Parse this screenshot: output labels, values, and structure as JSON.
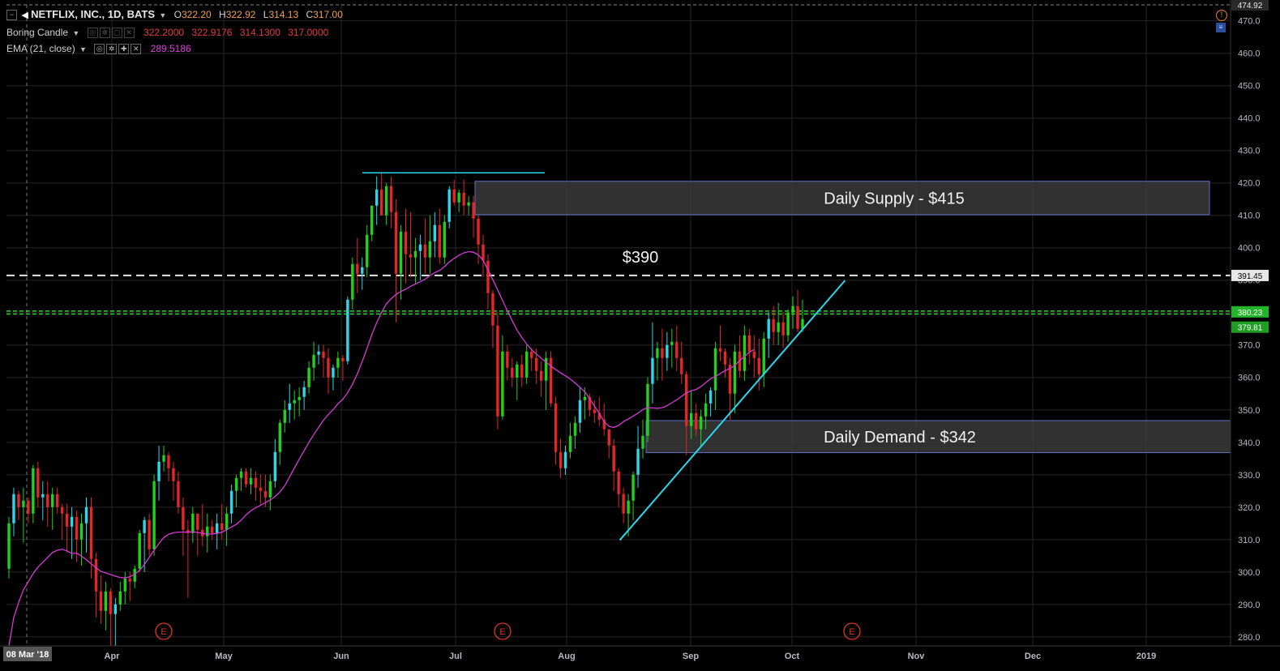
{
  "header": {
    "symbol": "NETFLIX, INC., 1D, BATS",
    "o_label": "O",
    "o_value": "322.20",
    "h_label": "H",
    "h_value": "322.92",
    "l_label": "L",
    "l_value": "314.13",
    "c_label": "C",
    "c_value": "317.00"
  },
  "indicators": {
    "candle_label": "Boring Candle",
    "candle_values": [
      "322.2000",
      "322.9176",
      "314.1300",
      "317.0000"
    ],
    "ema_label": "EMA (21, close)",
    "ema_value": "289.5186"
  },
  "colors": {
    "up_green": "#22d11c",
    "up_cyan": "#2fd5e8",
    "down_red": "#e32727",
    "ema": "#d63ad6",
    "trendline": "#27d9f0",
    "grid": "#262626",
    "zone_fill": "#3a3a3a",
    "zone_border": "#5f6fc4",
    "green_line": "#2fd32f"
  },
  "chart_data": {
    "type": "candlestick",
    "x_axis_labels": [
      "08 Mar '18",
      "Apr",
      "May",
      "Jun",
      "Jul",
      "Aug",
      "Sep",
      "Oct",
      "Nov",
      "Dec",
      "2019"
    ],
    "y_ticks": [
      470,
      460,
      450,
      440,
      430,
      420,
      410,
      400,
      390,
      380,
      370,
      360,
      350,
      340,
      330,
      320,
      310,
      300,
      290,
      280
    ],
    "ylim": [
      277.2,
      474.92
    ],
    "price_tags": {
      "top": "474.92",
      "white_line": "391.45",
      "green_1": "380.23",
      "green_2": "379.81"
    },
    "zones": [
      {
        "label": "Daily Supply - $415",
        "low": 410.2,
        "high": 420.5
      },
      {
        "label": "Daily Demand - $342",
        "low": 336.8,
        "high": 346.7
      }
    ],
    "level_label": "$390",
    "white_line_level": 391.45,
    "green_levels": [
      380.23,
      379.81
    ],
    "resistance_top": 423.1,
    "earnings_marker": "E",
    "candles_ohlc": [
      [
        301,
        317,
        298,
        315
      ],
      [
        315,
        326,
        311,
        324
      ],
      [
        324,
        325,
        316,
        320
      ],
      [
        320,
        326,
        309,
        322
      ],
      [
        322,
        323,
        315,
        318
      ],
      [
        318,
        333,
        315,
        332
      ],
      [
        332,
        334,
        320,
        323
      ],
      [
        323,
        328,
        316,
        324
      ],
      [
        324,
        328,
        314,
        320
      ],
      [
        320,
        326,
        313,
        324
      ],
      [
        324,
        326,
        318,
        320
      ],
      [
        320,
        321,
        310,
        318
      ],
      [
        318,
        321,
        306,
        314
      ],
      [
        314,
        320,
        304,
        317
      ],
      [
        317,
        319,
        303,
        310
      ],
      [
        310,
        318,
        302,
        315
      ],
      [
        315,
        323,
        306,
        320
      ],
      [
        320,
        323,
        298,
        304
      ],
      [
        304,
        306,
        286,
        294
      ],
      [
        294,
        299,
        284,
        288
      ],
      [
        288,
        297,
        282,
        294
      ],
      [
        294,
        295,
        276,
        287
      ],
      [
        287,
        292,
        276,
        290
      ],
      [
        290,
        297,
        288,
        294
      ],
      [
        294,
        300,
        290,
        298
      ],
      [
        298,
        300,
        291,
        297
      ],
      [
        297,
        302,
        295,
        301
      ],
      [
        301,
        313,
        300,
        312
      ],
      [
        312,
        317,
        300,
        316
      ],
      [
        316,
        318,
        305,
        307
      ],
      [
        307,
        330,
        305,
        328
      ],
      [
        328,
        339,
        322,
        334
      ],
      [
        334,
        339,
        331,
        336
      ],
      [
        336,
        337,
        328,
        332
      ],
      [
        332,
        334,
        322,
        328
      ],
      [
        328,
        331,
        318,
        320
      ],
      [
        320,
        323,
        305,
        313
      ],
      [
        313,
        316,
        292,
        312
      ],
      [
        312,
        320,
        309,
        318
      ],
      [
        318,
        318,
        305,
        313
      ],
      [
        313,
        321,
        308,
        311
      ],
      [
        311,
        318,
        306,
        314
      ],
      [
        314,
        316,
        310,
        312
      ],
      [
        312,
        318,
        307,
        315
      ],
      [
        315,
        321,
        310,
        313
      ],
      [
        313,
        320,
        308,
        318
      ],
      [
        318,
        327,
        315,
        325
      ],
      [
        325,
        330,
        320,
        329
      ],
      [
        329,
        332,
        325,
        331
      ],
      [
        331,
        332,
        326,
        327
      ],
      [
        327,
        332,
        324,
        329
      ],
      [
        329,
        331,
        322,
        326
      ],
      [
        326,
        330,
        321,
        325
      ],
      [
        325,
        330,
        320,
        323
      ],
      [
        323,
        330,
        319,
        328
      ],
      [
        328,
        341,
        326,
        337
      ],
      [
        337,
        347,
        333,
        346
      ],
      [
        346,
        353,
        343,
        350
      ],
      [
        350,
        358,
        346,
        352
      ],
      [
        352,
        356,
        347,
        353
      ],
      [
        353,
        357,
        348,
        354
      ],
      [
        354,
        359,
        350,
        357
      ],
      [
        357,
        365,
        355,
        363
      ],
      [
        363,
        371,
        359,
        367
      ],
      [
        367,
        370,
        364,
        368
      ],
      [
        368,
        370,
        360,
        366
      ],
      [
        366,
        369,
        355,
        360
      ],
      [
        360,
        364,
        356,
        363
      ],
      [
        363,
        368,
        360,
        366
      ],
      [
        366,
        367,
        359,
        365
      ],
      [
        365,
        385,
        364,
        384
      ],
      [
        384,
        397,
        381,
        395
      ],
      [
        395,
        403,
        386,
        392
      ],
      [
        392,
        397,
        387,
        394
      ],
      [
        394,
        407,
        391,
        404
      ],
      [
        404,
        413,
        402,
        413
      ],
      [
        413,
        422,
        407,
        418
      ],
      [
        418,
        423,
        410,
        410
      ],
      [
        410,
        420,
        407,
        419
      ],
      [
        419,
        422,
        406,
        411
      ],
      [
        411,
        415,
        377,
        392
      ],
      [
        392,
        407,
        384,
        405
      ],
      [
        405,
        412,
        389,
        398
      ],
      [
        398,
        411,
        391,
        397
      ],
      [
        397,
        403,
        389,
        399
      ],
      [
        399,
        404,
        390,
        401
      ],
      [
        401,
        409,
        392,
        397
      ],
      [
        397,
        410,
        392,
        402
      ],
      [
        402,
        411,
        397,
        407
      ],
      [
        407,
        412,
        395,
        397
      ],
      [
        397,
        410,
        395,
        408
      ],
      [
        408,
        419,
        406,
        418
      ],
      [
        418,
        421,
        413,
        414
      ],
      [
        414,
        418,
        411,
        417
      ],
      [
        417,
        421,
        410,
        413
      ],
      [
        413,
        416,
        410,
        414
      ],
      [
        414,
        416,
        403,
        409
      ],
      [
        409,
        410,
        395,
        401
      ],
      [
        401,
        404,
        391,
        396
      ],
      [
        396,
        398,
        381,
        386
      ],
      [
        386,
        387,
        369,
        376
      ],
      [
        376,
        380,
        344,
        348
      ],
      [
        348,
        373,
        347,
        368
      ],
      [
        368,
        370,
        359,
        363
      ],
      [
        363,
        366,
        357,
        360
      ],
      [
        360,
        365,
        353,
        364
      ],
      [
        364,
        367,
        357,
        360
      ],
      [
        360,
        370,
        358,
        368
      ],
      [
        368,
        369,
        362,
        366
      ],
      [
        366,
        369,
        358,
        362
      ],
      [
        362,
        365,
        354,
        359
      ],
      [
        359,
        368,
        350,
        366
      ],
      [
        366,
        368,
        351,
        352
      ],
      [
        352,
        354,
        333,
        337
      ],
      [
        337,
        341,
        329,
        332
      ],
      [
        332,
        339,
        330,
        337
      ],
      [
        337,
        346,
        335,
        342
      ],
      [
        342,
        348,
        338,
        346
      ],
      [
        346,
        357,
        343,
        353
      ],
      [
        353,
        357,
        347,
        354
      ],
      [
        354,
        355,
        348,
        350
      ],
      [
        350,
        353,
        346,
        349
      ],
      [
        349,
        354,
        345,
        347
      ],
      [
        347,
        352,
        342,
        344
      ],
      [
        344,
        344,
        335,
        339
      ],
      [
        339,
        341,
        325,
        331
      ],
      [
        331,
        332,
        320,
        324
      ],
      [
        324,
        326,
        315,
        318
      ],
      [
        318,
        324,
        311,
        322
      ],
      [
        322,
        331,
        316,
        330
      ],
      [
        330,
        345,
        326,
        338
      ],
      [
        338,
        347,
        335,
        342
      ],
      [
        342,
        360,
        340,
        358
      ],
      [
        358,
        377,
        352,
        366
      ],
      [
        366,
        371,
        359,
        369
      ],
      [
        369,
        375,
        359,
        366
      ],
      [
        366,
        374,
        362,
        370
      ],
      [
        370,
        375,
        363,
        371
      ],
      [
        371,
        376,
        362,
        366
      ],
      [
        366,
        371,
        358,
        361
      ],
      [
        361,
        362,
        336,
        345
      ],
      [
        345,
        356,
        341,
        349
      ],
      [
        349,
        352,
        342,
        344
      ],
      [
        344,
        350,
        339,
        348
      ],
      [
        348,
        355,
        344,
        352
      ],
      [
        352,
        357,
        348,
        356
      ],
      [
        356,
        371,
        350,
        369
      ],
      [
        369,
        376,
        365,
        368
      ],
      [
        368,
        369,
        360,
        364
      ],
      [
        364,
        366,
        347,
        355
      ],
      [
        355,
        370,
        349,
        368
      ],
      [
        368,
        373,
        360,
        362
      ],
      [
        362,
        376,
        359,
        373
      ],
      [
        373,
        375,
        364,
        368
      ],
      [
        368,
        373,
        360,
        366
      ],
      [
        366,
        372,
        356,
        361
      ],
      [
        361,
        374,
        357,
        372
      ],
      [
        372,
        380,
        366,
        378
      ],
      [
        378,
        382,
        370,
        374
      ],
      [
        374,
        383,
        370,
        377
      ],
      [
        377,
        380,
        369,
        373
      ],
      [
        373,
        381,
        371,
        380
      ],
      [
        380,
        385,
        375,
        382
      ],
      [
        382,
        387,
        374,
        375
      ],
      [
        375,
        384,
        374,
        378
      ]
    ],
    "ema_21": [
      [
        0,
        277.2
      ],
      [
        1,
        286
      ],
      [
        2,
        290.5
      ],
      [
        3,
        294.5
      ],
      [
        4,
        297
      ],
      [
        5,
        299.5
      ],
      [
        6,
        301.5
      ],
      [
        7,
        303
      ],
      [
        8,
        304.5
      ],
      [
        9,
        306
      ],
      [
        10,
        306.7
      ],
      [
        11,
        307
      ],
      [
        12,
        306.5
      ],
      [
        13,
        305.7
      ],
      [
        14,
        305.8
      ],
      [
        15,
        304.9
      ],
      [
        16,
        303.8
      ],
      [
        17,
        302.5
      ],
      [
        18,
        301.3
      ],
      [
        19,
        300.2
      ],
      [
        20,
        299.7
      ],
      [
        21,
        299.2
      ],
      [
        22,
        298.7
      ],
      [
        23,
        298.3
      ],
      [
        24,
        298.2
      ],
      [
        25,
        298.5
      ],
      [
        26,
        299.3
      ],
      [
        27,
        300.5
      ],
      [
        28,
        302.3
      ],
      [
        29,
        304.5
      ],
      [
        30,
        306.7
      ],
      [
        31,
        308.8
      ],
      [
        32,
        310.6
      ],
      [
        33,
        311.6
      ],
      [
        34,
        312.1
      ],
      [
        35,
        312.3
      ],
      [
        36,
        312.3
      ],
      [
        37,
        312.3
      ],
      [
        38,
        312.4
      ],
      [
        39,
        312.2
      ],
      [
        40,
        311.9
      ],
      [
        41,
        311.7
      ],
      [
        42,
        311.7
      ],
      [
        43,
        311.9
      ],
      [
        44,
        312.3
      ],
      [
        45,
        313
      ],
      [
        46,
        313.9
      ],
      [
        47,
        314.7
      ],
      [
        48,
        316
      ],
      [
        49,
        317.6
      ],
      [
        50,
        318.9
      ],
      [
        51,
        319.8
      ],
      [
        52,
        320.6
      ],
      [
        53,
        321.4
      ],
      [
        54,
        322.2
      ],
      [
        55,
        323.3
      ],
      [
        56,
        324.7
      ],
      [
        57,
        326.6
      ],
      [
        58,
        329.3
      ],
      [
        59,
        332.1
      ],
      [
        60,
        334.8
      ],
      [
        61,
        337.4
      ],
      [
        62,
        340
      ],
      [
        63,
        342.4
      ],
      [
        64,
        344.6
      ],
      [
        65,
        346.8
      ],
      [
        66,
        348.6
      ],
      [
        67,
        350.1
      ],
      [
        68,
        351.9
      ],
      [
        69,
        353.3
      ],
      [
        70,
        355.3
      ],
      [
        71,
        357.9
      ],
      [
        72,
        361.1
      ],
      [
        73,
        364.9
      ],
      [
        74,
        368.9
      ],
      [
        75,
        373.2
      ],
      [
        76,
        376.9
      ],
      [
        77,
        380.1
      ],
      [
        78,
        382.7
      ],
      [
        79,
        384.3
      ],
      [
        80,
        385.6
      ],
      [
        81,
        386.5
      ],
      [
        82,
        387.2
      ],
      [
        83,
        388.1
      ],
      [
        84,
        388.8
      ],
      [
        85,
        389.5
      ],
      [
        86,
        390.3
      ],
      [
        87,
        391.4
      ],
      [
        88,
        392.3
      ],
      [
        89,
        393
      ],
      [
        90,
        394.2
      ],
      [
        91,
        395.6
      ],
      [
        92,
        396.7
      ],
      [
        93,
        397.7
      ],
      [
        94,
        398.4
      ],
      [
        95,
        398.8
      ],
      [
        96,
        398.6
      ],
      [
        97,
        397.8
      ],
      [
        98,
        396.1
      ],
      [
        99,
        393.2
      ],
      [
        100,
        390.1
      ],
      [
        101,
        387
      ],
      [
        102,
        383.8
      ],
      [
        103,
        380.5
      ],
      [
        104,
        377.5
      ],
      [
        105,
        374.6
      ],
      [
        106,
        372.3
      ],
      [
        107,
        370.3
      ],
      [
        108,
        368.6
      ],
      [
        109,
        367.2
      ],
      [
        110,
        365.9
      ],
      [
        111,
        364.7
      ],
      [
        112,
        363.5
      ],
      [
        113,
        362.4
      ],
      [
        114,
        361.4
      ],
      [
        115,
        360.5
      ],
      [
        116,
        359.5
      ],
      [
        117,
        358.3
      ],
      [
        118,
        357
      ],
      [
        119,
        355.6
      ],
      [
        120,
        353.5
      ],
      [
        121,
        351.2
      ],
      [
        122,
        348.9
      ],
      [
        123,
        346.4
      ],
      [
        124,
        344.9
      ],
      [
        125,
        344.6
      ],
      [
        126,
        345.2
      ],
      [
        127,
        346.4
      ],
      [
        128,
        347.2
      ],
      [
        129,
        348.1
      ],
      [
        130,
        349
      ],
      [
        131,
        350.1
      ],
      [
        132,
        350.7
      ],
      [
        133,
        350.6
      ],
      [
        134,
        350.5
      ],
      [
        135,
        350.7
      ],
      [
        136,
        351.3
      ],
      [
        137,
        352.2
      ],
      [
        138,
        353.1
      ],
      [
        139,
        354.2
      ],
      [
        140,
        355.2
      ],
      [
        141,
        355.9
      ],
      [
        142,
        356.3
      ],
      [
        143,
        357.2
      ],
      [
        144,
        358.4
      ],
      [
        145,
        359.6
      ],
      [
        146,
        360.3
      ],
      [
        147,
        361.2
      ],
      [
        148,
        362.1
      ],
      [
        149,
        362.8
      ],
      [
        150,
        363.7
      ],
      [
        151,
        365.2
      ],
      [
        152,
        366.4
      ],
      [
        153,
        367.8
      ],
      [
        154,
        368.6
      ]
    ],
    "trendline": [
      [
        0.501,
        309.8
      ],
      [
        0.685,
        389.9
      ]
    ]
  }
}
